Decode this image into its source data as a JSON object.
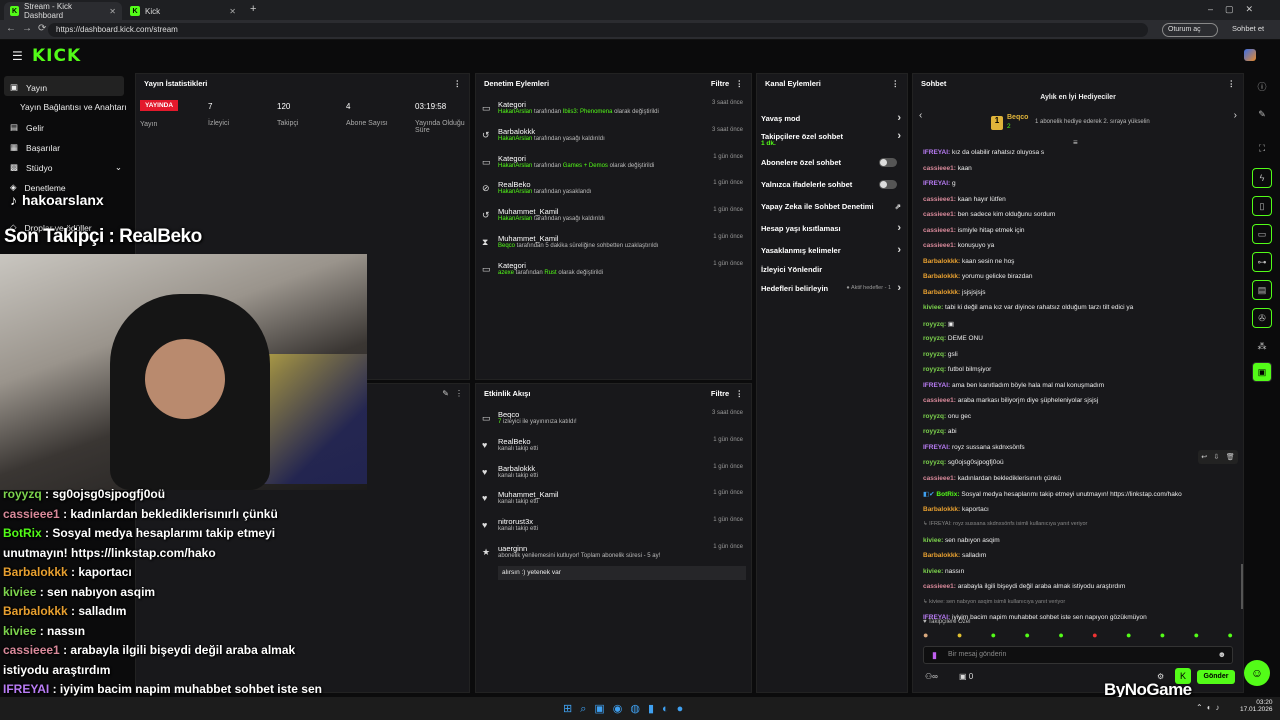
{
  "browser": {
    "tabs": [
      "Stream - Kick Dashboard",
      "Kick"
    ],
    "url": "https://dashboard.kick.com/stream",
    "profile": "Oturum aç",
    "chat_btn": "Sohbet et"
  },
  "logo": "KICK",
  "sidebar": {
    "items": [
      "Yayın",
      "Yayın Bağlantısı ve Anahtarı",
      "Gelir",
      "Başarılar",
      "Stüdyo",
      "Denetleme",
      "Droplar ve ödüller"
    ]
  },
  "overlay": {
    "user": "hakoarslanx",
    "last_follower": "Son Takipçi : RealBeko",
    "chat": [
      {
        "u": "royyzq",
        "m": "sg0ojsg0sjpogfj0oü",
        "c": "#7cd34d"
      },
      {
        "u": "cassieee1",
        "m": "kadınlardan beklediklerisınırlı çünkü",
        "c": "#d8899a"
      },
      {
        "u": "BotRix",
        "m": "Sosyal medya hesaplarımı takip etmeyi",
        "c": "#53fc18"
      },
      {
        "u": "",
        "m": "unutmayın! https://linkstap.com/hako",
        "c": "#fff"
      },
      {
        "u": "Barbalokkk",
        "m": "kaportacı",
        "c": "#e8a030"
      },
      {
        "u": "kiviee",
        "m": "sen nabıyon asqim",
        "c": "#7cd34d"
      },
      {
        "u": "Barbalokkk",
        "m": "salladım",
        "c": "#e8a030"
      },
      {
        "u": "kiviee",
        "m": "nassın",
        "c": "#7cd34d"
      },
      {
        "u": "cassieee1",
        "m": "arabayla ilgili bişeydi değil araba almak",
        "c": "#d8899a"
      },
      {
        "u": "",
        "m": "istiyodu araştırdım",
        "c": "#fff"
      },
      {
        "u": "IFREYAI",
        "m": "iyiyim bacim napim muhabbet sohbet iste sen",
        "c": "#b97cf5"
      },
      {
        "u": "",
        "m": "napıyon gözükmüyon",
        "c": "#fff"
      }
    ]
  },
  "stats": {
    "title": "Yayın İstatistikleri",
    "status": "YAYINDA",
    "status_label": "Yayın",
    "viewers": "7",
    "viewers_label": "İzleyici",
    "followers": "120",
    "followers_label": "Takipçi",
    "subs": "4",
    "subs_label": "Abone Sayısı",
    "uptime": "03:19:58",
    "uptime_label": "Yayında Olduğu Süre"
  },
  "mod": {
    "title": "Denetim Eylemleri",
    "filter": "Filtre",
    "items": [
      {
        "t": "Kategori",
        "s1": "HakanArslan",
        "s2": " tarafından ",
        "s3": "Ibiis3: Phenomena",
        "s4": " olarak değiştirildi",
        "time": "3 saat önce",
        "icon": "▭"
      },
      {
        "t": "Barbalokkk",
        "s1": "HakanArslan",
        "s2": " tarafından yasağı kaldırıldı",
        "s3": "",
        "s4": "",
        "time": "3 saat önce",
        "icon": "↺"
      },
      {
        "t": "Kategori",
        "s1": "HakanArslan",
        "s2": " tarafından ",
        "s3": "Games + Demos",
        "s4": " olarak değiştirildi",
        "time": "1 gün önce",
        "icon": "▭"
      },
      {
        "t": "RealBeko",
        "s1": "HakanArslan",
        "s2": " tarafından yasaklandı",
        "s3": "",
        "s4": "",
        "time": "1 gün önce",
        "icon": "⊘"
      },
      {
        "t": "Muhammet_Kamil",
        "s1": "HakanArslan",
        "s2": " tarafından yasağı kaldırıldı",
        "s3": "",
        "s4": "",
        "time": "1 gün önce",
        "icon": "↺"
      },
      {
        "t": "Muhammet_Kamil",
        "s1": "Beqco",
        "s2": " tarafından 5 dakika süreliğine sohbetten uzaklaştırıldı",
        "s3": "",
        "s4": "",
        "time": "1 gün önce",
        "icon": "⧗"
      },
      {
        "t": "Kategori",
        "s1": "azexe",
        "s2": " tarafından ",
        "s3": "Rust",
        "s4": " olarak değiştirildi",
        "time": "1 gün önce",
        "icon": "▭"
      }
    ]
  },
  "activity": {
    "title": "Etkinlik Akışı",
    "filter": "Filtre",
    "items": [
      {
        "t": "Beqco",
        "s1": "7",
        "s2": " izleyici ile yayınınıza katıldı!",
        "time": "3 saat önce",
        "icon": "▭"
      },
      {
        "t": "RealBeko",
        "s1": "",
        "s2": "kanalı takip etti",
        "time": "1 gün önce",
        "icon": "♥"
      },
      {
        "t": "Barbalokkk",
        "s1": "",
        "s2": "kanalı takip etti",
        "time": "1 gün önce",
        "icon": "♥"
      },
      {
        "t": "Muhammet_Kamil",
        "s1": "",
        "s2": "kanalı takip etti",
        "time": "1 gün önce",
        "icon": "♥"
      },
      {
        "t": "nitrorust3x",
        "s1": "",
        "s2": "kanalı takip etti",
        "time": "1 gün önce",
        "icon": "♥"
      },
      {
        "t": "uaerginn",
        "s1": "",
        "s2": "abonelik yenilemesini kutluyor! Toplam abonelik süresi - 5 ay!",
        "time": "1 gün önce",
        "icon": "★"
      }
    ],
    "sub_msg": "alırsın :) yetenek var"
  },
  "channel": {
    "title": "Kanal Eylemleri",
    "items": [
      {
        "l": "Yavaş mod",
        "kind": "arrow"
      },
      {
        "l": "Takipçilere özel sohbet",
        "sub": "1 dk.",
        "kind": "arrow"
      },
      {
        "l": "Abonelere özel sohbet",
        "kind": "toggle"
      },
      {
        "l": "Yalnızca ifadelerle sohbet",
        "kind": "toggle"
      },
      {
        "l": "Yapay Zeka ile Sohbet Denetimi",
        "kind": "ext"
      },
      {
        "l": "Hesap yaşı kısıtlaması",
        "kind": "arrow"
      },
      {
        "l": "Yasaklanmış kelimeler",
        "kind": "arrow"
      },
      {
        "l": "İzleyici Yönlendir",
        "kind": "none"
      },
      {
        "l": "Hedefleri belirleyin",
        "sub": "Aktif hedefler - 1",
        "kind": "arrow"
      }
    ]
  },
  "chat": {
    "title": "Sohbet",
    "gifter_title": "Aylık en İyi Hediyeciler",
    "gifter": "Beqco",
    "gifter_count": "2",
    "gifter_hint": "1 abonelik hediye ederek 2. sıraya yükselin",
    "placeholder": "Bir mesaj gönderin",
    "send": "Gönder",
    "follower_note": "Takipçilere Özel",
    "count": "0",
    "msgs": [
      {
        "u": "IFREYAI",
        "m": "kız da olabilir rahatsız oluyosa s",
        "c": "#b97cf5"
      },
      {
        "u": "cassieee1",
        "m": "kaan",
        "c": "#d8899a"
      },
      {
        "u": "IFREYAI",
        "m": "g",
        "c": "#b97cf5"
      },
      {
        "u": "cassieee1",
        "m": "kaan hayır lütfen",
        "c": "#d8899a"
      },
      {
        "u": "cassieee1",
        "m": "ben sadece kim olduğunu sordum",
        "c": "#d8899a"
      },
      {
        "u": "cassieee1",
        "m": "ismiyle hitap etmek için",
        "c": "#d8899a"
      },
      {
        "u": "cassieee1",
        "m": "konuşuyo ya",
        "c": "#d8899a"
      },
      {
        "u": "Barbalokkk",
        "m": "kaan sesin ne hoş",
        "c": "#e8a030"
      },
      {
        "u": "Barbalokkk",
        "m": "yorumu gelicke birazdan",
        "c": "#e8a030"
      },
      {
        "u": "Barbalokkk",
        "m": "jsjsjsjsjs",
        "c": "#e8a030"
      },
      {
        "u": "kiviee",
        "m": "tabi ki değil ama kız var diyince rahatsız olduğum tarzı tilt edici ya",
        "c": "#7cd34d"
      },
      {
        "u": "royyzq",
        "m": "▣",
        "c": "#7cd34d"
      },
      {
        "u": "royyzq",
        "m": "DEME ONU",
        "c": "#7cd34d"
      },
      {
        "u": "royyzq",
        "m": "gsli",
        "c": "#7cd34d"
      },
      {
        "u": "royyzq",
        "m": "futbol bilmşiyor",
        "c": "#7cd34d"
      },
      {
        "u": "IFREYAI",
        "m": "ama ben kanıtladım böyle hala mal mal konuşmadım",
        "c": "#b97cf5"
      },
      {
        "u": "cassieee1",
        "m": "araba markası biliyorjm diye şüpheleniyolar sjsjsj",
        "c": "#d8899a"
      },
      {
        "u": "royyzq",
        "m": "onu gec",
        "c": "#7cd34d"
      },
      {
        "u": "royyzq",
        "m": "abi",
        "c": "#7cd34d"
      },
      {
        "u": "IFREYAI",
        "m": "royz sussana skdnxsönfs",
        "c": "#b97cf5"
      },
      {
        "u": "royyzq",
        "m": "sg0ojsg0sjpogfj0oü",
        "c": "#7cd34d"
      },
      {
        "u": "cassieee1",
        "m": "kadınlardan beklediklerisınırlı çünkü",
        "c": "#d8899a"
      },
      {
        "u": "BotRix",
        "m": "Sosyal medya hesaplarımı takip etmeyi unutmayın! https://linkstap.com/hako",
        "c": "#53fc18"
      },
      {
        "u": "Barbalokkk",
        "m": "kaportacı",
        "c": "#e8a030"
      },
      {
        "reply": "↳ IFREYAI: royz sussana skdnxsönfs isimli kullanıcıya yanıt veriyor"
      },
      {
        "u": "kiviee",
        "m": "sen nabıyon asqim",
        "c": "#7cd34d"
      },
      {
        "u": "Barbalokkk",
        "m": "salladım",
        "c": "#e8a030"
      },
      {
        "u": "kiviee",
        "m": "nassın",
        "c": "#7cd34d"
      },
      {
        "u": "cassieee1",
        "m": "arabayla ilgili bişeydi değil araba almak istiyodu araştırdım",
        "c": "#d8899a"
      },
      {
        "reply": "↳ kiviee: sen nabıyon asqim isimli kullanıcıya yanıt veriyor"
      },
      {
        "u": "IFREYAI",
        "m": "iyiyim bacim napim muhabbet sohbet iste sen napıyon gözükmüyon",
        "c": "#b97cf5"
      }
    ]
  },
  "watermark": "ByNoGame",
  "clock": {
    "time": "03:20",
    "date": "17.01.2026"
  }
}
